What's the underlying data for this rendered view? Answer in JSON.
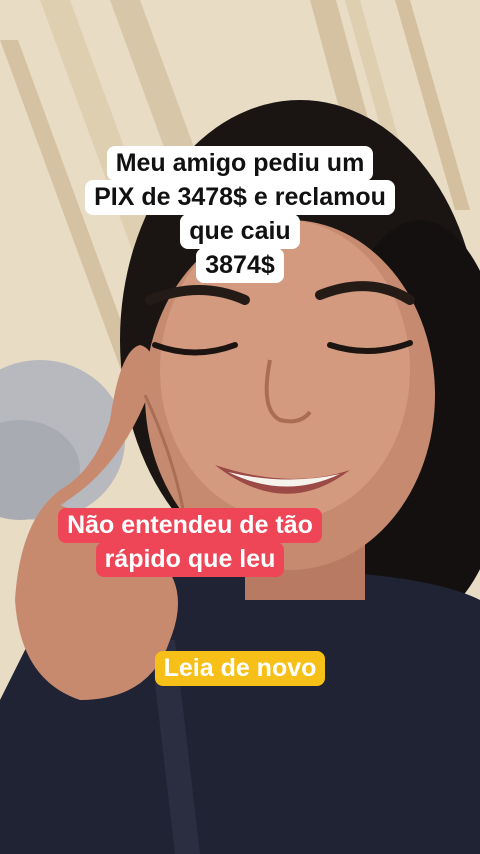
{
  "video": {
    "captions": {
      "top": [
        "Meu amigo pediu um",
        "PIX de 3478$ e reclamou",
        "que caiu",
        "3874$"
      ],
      "middle": [
        "Não entendeu de tão",
        "rápido que leu"
      ],
      "bottom": [
        "Leia de novo"
      ]
    }
  },
  "colors": {
    "caption_white": "#ffffff",
    "caption_red": "#ee4557",
    "caption_yellow": "#f6c018"
  }
}
